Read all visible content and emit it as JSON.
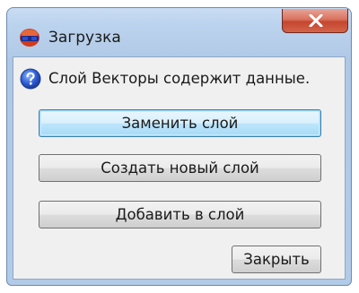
{
  "window": {
    "title": "Загрузка",
    "close_glyph": "×"
  },
  "message": {
    "icon": "question-icon",
    "text": "Слой Векторы содержит данные."
  },
  "buttons": {
    "replace_label": "Заменить слой",
    "create_label": "Создать новый слой",
    "append_label": "Добавить в слой",
    "close_label": "Закрыть"
  },
  "colors": {
    "close_button": "#c5462f",
    "default_button_border": "#3c7fb1",
    "client_bg": "#f0f0f0",
    "frame": "#b5cde9"
  }
}
